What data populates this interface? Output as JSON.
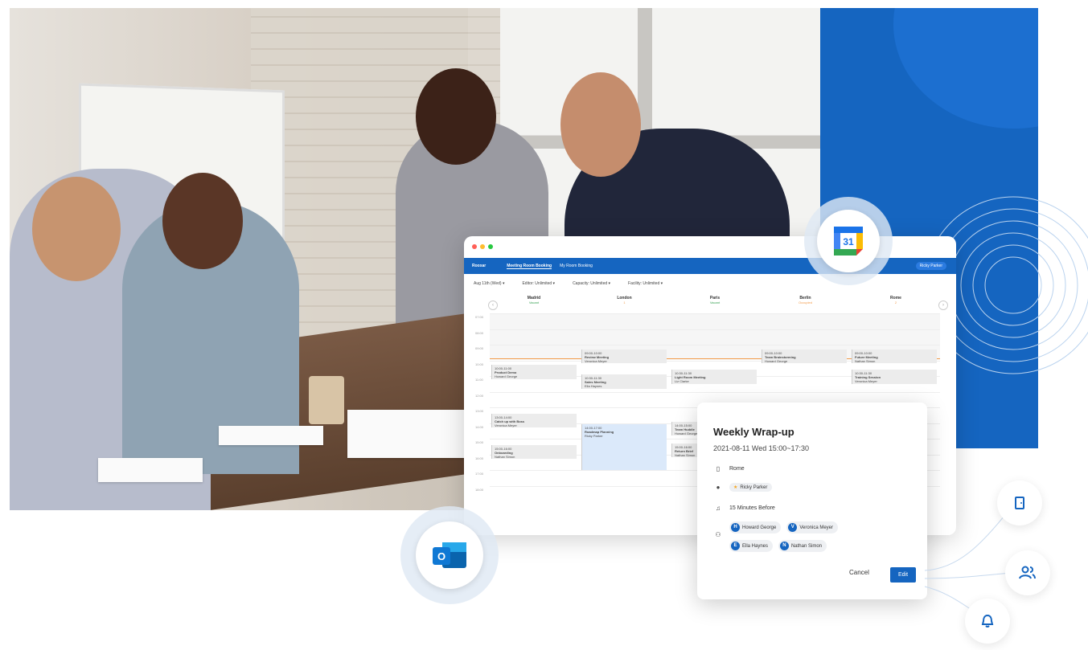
{
  "app": {
    "brand": "Rooxar",
    "tabs": [
      "Meeting Room Booking",
      "My Room Booking"
    ],
    "user": "Ricky Parker",
    "filters": [
      "Aug 11th (Wed) ▾",
      "Editor: Unlimited ▾",
      "Capacity: Unlimited ▾",
      "Facility: Unlimited ▾"
    ],
    "locations": [
      {
        "name": "Madrid",
        "status": "Vacant"
      },
      {
        "name": "London",
        "status": "1"
      },
      {
        "name": "Paris",
        "status": "Vacant"
      },
      {
        "name": "Berlin",
        "status": "Occupied"
      },
      {
        "name": "Rome",
        "status": "2"
      }
    ],
    "times": [
      "07:00",
      "08:00",
      "09:00",
      "10:00",
      "11:00",
      "12:00",
      "13:00",
      "14:00",
      "15:00",
      "16:00",
      "17:00",
      "18:00"
    ],
    "events": [
      {
        "title": "Product Demo",
        "who": "Howard George",
        "time": "10:00-11:00"
      },
      {
        "title": "Review Meeting",
        "who": "Veronica Meyer",
        "time": "09:00-10:00"
      },
      {
        "title": "Sales Meeting",
        "who": "Ella Haynes",
        "time": "10:30-11:30"
      },
      {
        "title": "Catch up with Boss",
        "who": "Veronica Meyer",
        "time": "13:00-14:00"
      },
      {
        "title": "Roadmap Planning",
        "who": "Ricky Parker",
        "time": "14:00-17:00"
      },
      {
        "title": "Onboarding",
        "who": "Nathan Simon",
        "time": "15:00-16:00"
      },
      {
        "title": "Light Room Meeting",
        "who": "Liz Clarke",
        "time": "10:30-11:30"
      },
      {
        "title": "Team Huddle",
        "who": "Howard George",
        "time": "14:00-15:00"
      },
      {
        "title": "Return Brief",
        "who": "Nathan Simon",
        "time": "15:00-16:00"
      },
      {
        "title": "Team Brainstorming",
        "who": "Howard George",
        "time": "09:00-10:00"
      },
      {
        "title": "Future Meeting",
        "who": "Nathan Simon",
        "time": "09:00-10:00"
      },
      {
        "title": "Training Session",
        "who": "Veronica Meyer",
        "time": "10:30-11:30"
      }
    ]
  },
  "popup": {
    "title": "Weekly Wrap-up",
    "datetime": "2021-08-11 Wed 15:00~17:30",
    "room": "Rome",
    "organizer": "Ricky Parker",
    "reminder": "15 Minutes Before",
    "attendees": [
      {
        "initial": "H",
        "name": "Howard George"
      },
      {
        "initial": "V",
        "name": "Veronica Meyer"
      },
      {
        "initial": "E",
        "name": "Ella Haynes"
      },
      {
        "initial": "N",
        "name": "Nathan Simon"
      }
    ],
    "cancel": "Cancel",
    "edit": "Edit"
  },
  "badges": {
    "gcal_number": "31",
    "outlook_letter": "O"
  },
  "colors": {
    "brand_blue": "#1565c0",
    "now_line": "#f39c4b",
    "vacant_green": "#3aa356"
  }
}
